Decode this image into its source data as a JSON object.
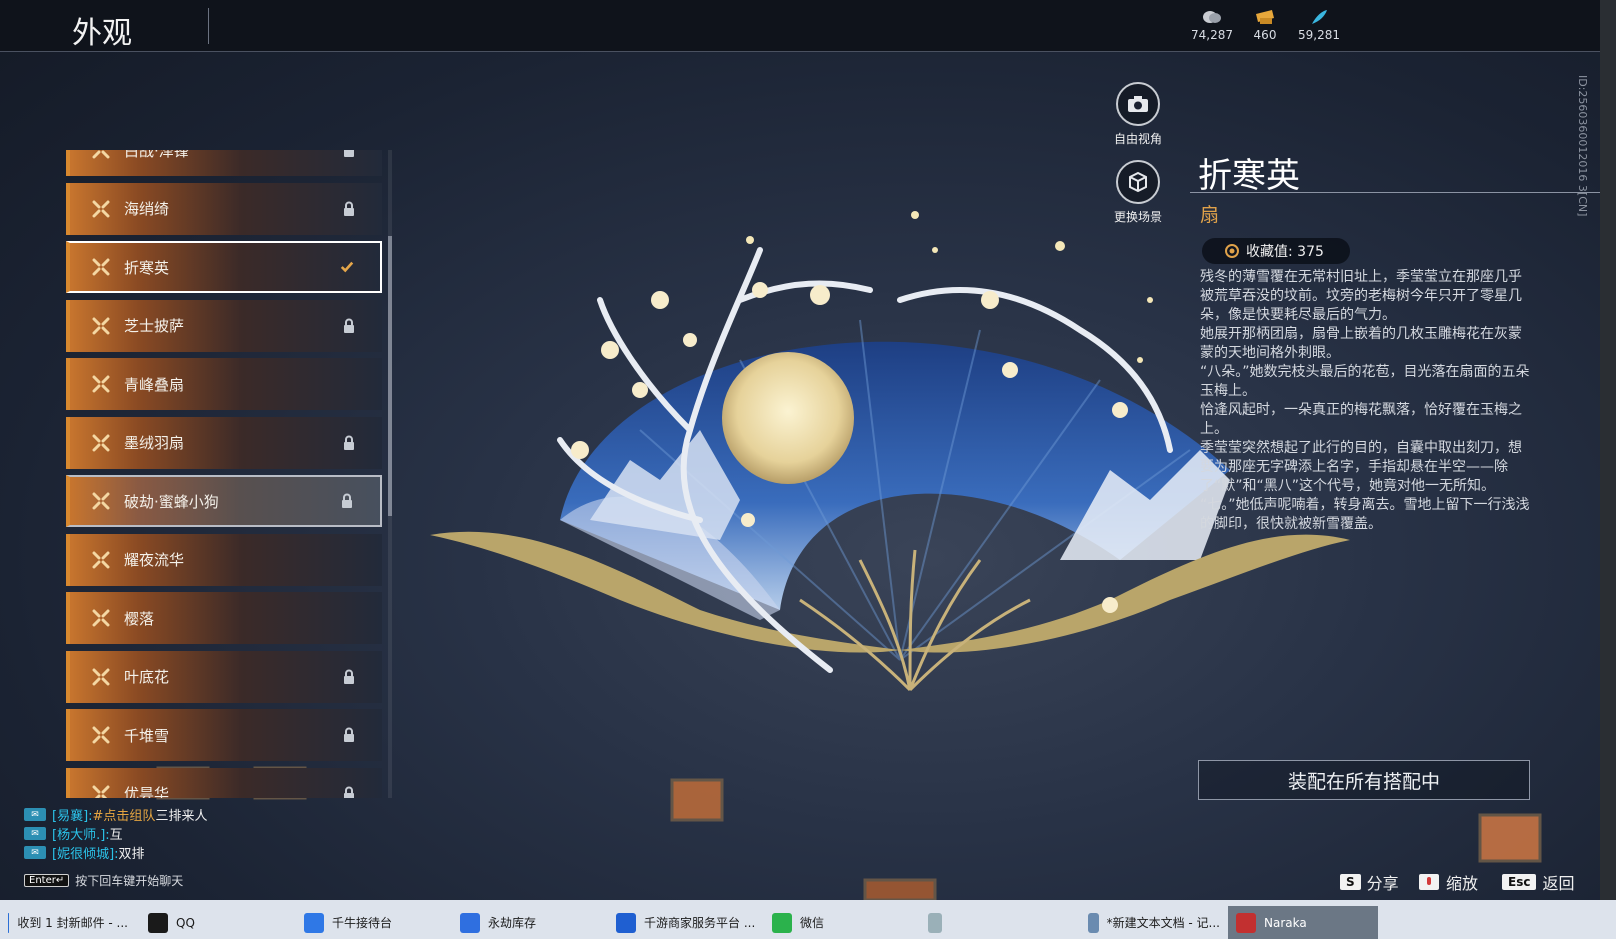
{
  "header": {
    "title": "外观",
    "currencies": [
      {
        "icon": "coin-icon",
        "value": "74,287"
      },
      {
        "icon": "gold-ticket-icon",
        "value": "460"
      },
      {
        "icon": "feather-icon",
        "value": "59,281"
      }
    ]
  },
  "camera": {
    "free_view": "自由视角",
    "change_scene": "更换场景"
  },
  "skin_list": [
    {
      "label": "白战·泽锋",
      "locked": true
    },
    {
      "label": "海绡绮",
      "locked": true
    },
    {
      "label": "折寒英",
      "locked": false,
      "selected": true
    },
    {
      "label": "芝士披萨",
      "locked": true
    },
    {
      "label": "青峰叠扇",
      "locked": false
    },
    {
      "label": "墨绒羽扇",
      "locked": true
    },
    {
      "label": "破劫·蜜蜂小狗",
      "locked": true,
      "hover": true
    },
    {
      "label": "耀夜流华",
      "locked": false
    },
    {
      "label": "樱落",
      "locked": false
    },
    {
      "label": "叶底花",
      "locked": true
    },
    {
      "label": "千堆雪",
      "locked": true
    },
    {
      "label": "优昙华",
      "locked": true
    }
  ],
  "detail": {
    "name": "折寒英",
    "type": "扇",
    "collection_label": "收藏值: 375",
    "description": [
      "残冬的薄雪覆在无常村旧址上，季莹莹立在那座几乎被荒草吞没的坟前。坟旁的老梅树今年只开了零星几朵，像是快要耗尽最后的气力。",
      "她展开那柄团扇，扇骨上嵌着的几枚玉雕梅花在灰蒙蒙的天地间格外刺眼。",
      "“八朵。”她数完枝头最后的花苞，目光落在扇面的五朵玉梅上。",
      "恰逢风起时，一朵真正的梅花飘落，恰好覆在玉梅之上。",
      "季莹莹突然想起了此行的目的，自囊中取出刻刀，想要为那座无字碑添上名字，手指却悬在半空——除了“默”和“黑八”这个代号，她竟对他一无所知。",
      "“七。”她低声呢喃着，转身离去。雪地上留下一行浅浅的脚印，很快就被新雪覆盖。"
    ],
    "equip_label": "装配在所有搭配中",
    "side_id": "ID:2560360012016 3[CN]"
  },
  "chat": {
    "lines": [
      {
        "who": "[易襄]:",
        "highlight": "#点击组队",
        "msg": " 三排来人"
      },
      {
        "who": "[杨大师.]:",
        "highlight": "",
        "msg": "互"
      },
      {
        "who": "[妮很倾城]:",
        "highlight": "",
        "msg": "双排"
      }
    ],
    "enter_key": "Enter↵",
    "hint": "按下回车键开始聊天"
  },
  "hotkeys": [
    {
      "key": "S",
      "label": "分享"
    },
    {
      "key": "",
      "label": "缩放"
    },
    {
      "key": "Esc",
      "label": "返回"
    }
  ],
  "taskbar": [
    {
      "label": "收到 1 封新邮件 - ...",
      "color": "#2b6fd6"
    },
    {
      "label": "QQ",
      "color": "#1a1a1a"
    },
    {
      "label": "千牛接待台",
      "color": "#2f78e6"
    },
    {
      "label": "永劫库存",
      "color": "#2f6fe0"
    },
    {
      "label": "千游商家服务平台 ...",
      "color": "#1f5fd1"
    },
    {
      "label": "微信",
      "color": "#2bb24c"
    },
    {
      "label": "",
      "color": "#9ab0b8"
    },
    {
      "label": "*新建文本文档 - 记...",
      "color": "#6a8bb0"
    },
    {
      "label": "Naraka",
      "color": "#c23030"
    }
  ]
}
